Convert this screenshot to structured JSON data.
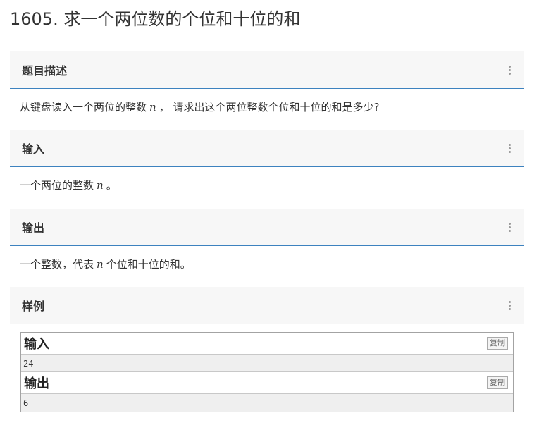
{
  "problem": {
    "title": "1605. 求一个两位数的个位和十位的和"
  },
  "sections": {
    "description": {
      "title": "题目描述",
      "text_before": "从键盘读入一个两位的整数",
      "var": "n",
      "text_after": "， 请求出这个两位整数个位和十位的和是多少?"
    },
    "input": {
      "title": "输入",
      "text_before": "一个两位的整数",
      "var": "n",
      "text_after": "。"
    },
    "output": {
      "title": "输出",
      "text_before": "一个整数，代表",
      "var": "n",
      "text_after": "个位和十位的和。"
    },
    "sample": {
      "title": "样例",
      "input_label": "输入",
      "input_value": "24",
      "output_label": "输出",
      "output_value": "6",
      "copy_label": "复制"
    }
  }
}
